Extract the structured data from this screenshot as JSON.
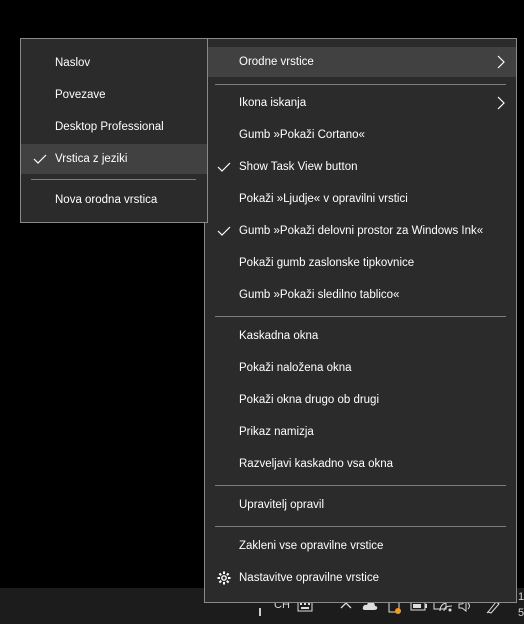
{
  "main_menu": {
    "items": [
      {
        "label": "Orodne vrstice",
        "submenu": true,
        "highlighted": true
      },
      {
        "label": "Ikona iskanja",
        "submenu": true
      },
      {
        "label": "Gumb »Pokaži Cortano«"
      },
      {
        "label": "Show Task View button",
        "checked": true
      },
      {
        "label": "Pokaži »Ljudje« v opravilni vrstici"
      },
      {
        "label": "Gumb »Pokaži delovni prostor za Windows Ink«",
        "checked": true
      },
      {
        "label": "Pokaži gumb zaslonske tipkovnice"
      },
      {
        "label": "Gumb »Pokaži sledilno tablico«"
      },
      {
        "label": "Kaskadna okna"
      },
      {
        "label": "Pokaži naložena okna"
      },
      {
        "label": "Pokaži okna drugo ob drugi"
      },
      {
        "label": "Prikaz namizja"
      },
      {
        "label": "Razveljavi kaskadno vsa okna"
      },
      {
        "label": "Upravitelj opravil"
      },
      {
        "label": "Zakleni vse opravilne vrstice"
      },
      {
        "label": "Nastavitve opravilne vrstice",
        "icon": "gear-icon"
      }
    ]
  },
  "sub_menu": {
    "items": [
      {
        "label": "Naslov"
      },
      {
        "label": "Povezave"
      },
      {
        "label": "Desktop Professional"
      },
      {
        "label": "Vrstica z jeziki",
        "checked": true,
        "highlighted": true
      },
      {
        "label": "Nova orodna vrstica"
      }
    ]
  },
  "taskbar": {
    "language": "CH",
    "clock_partial_line1": "1",
    "clock_partial_line2": "5",
    "tray_icons": [
      "pipe-icon",
      "keyboard-icon",
      "chevron-up-icon",
      "cloud-icon",
      "onedrive-icon",
      "battery-icon",
      "display-icon",
      "wifi-icon",
      "volume-icon",
      "pen-icon"
    ]
  },
  "colors": {
    "menu_bg": "#2b2b2b",
    "highlight": "#414141",
    "separator": "#7d7d7d",
    "border": "#8a8a8a",
    "taskbar": "#1c1c1c",
    "notification_dot": "#f39a1e"
  }
}
